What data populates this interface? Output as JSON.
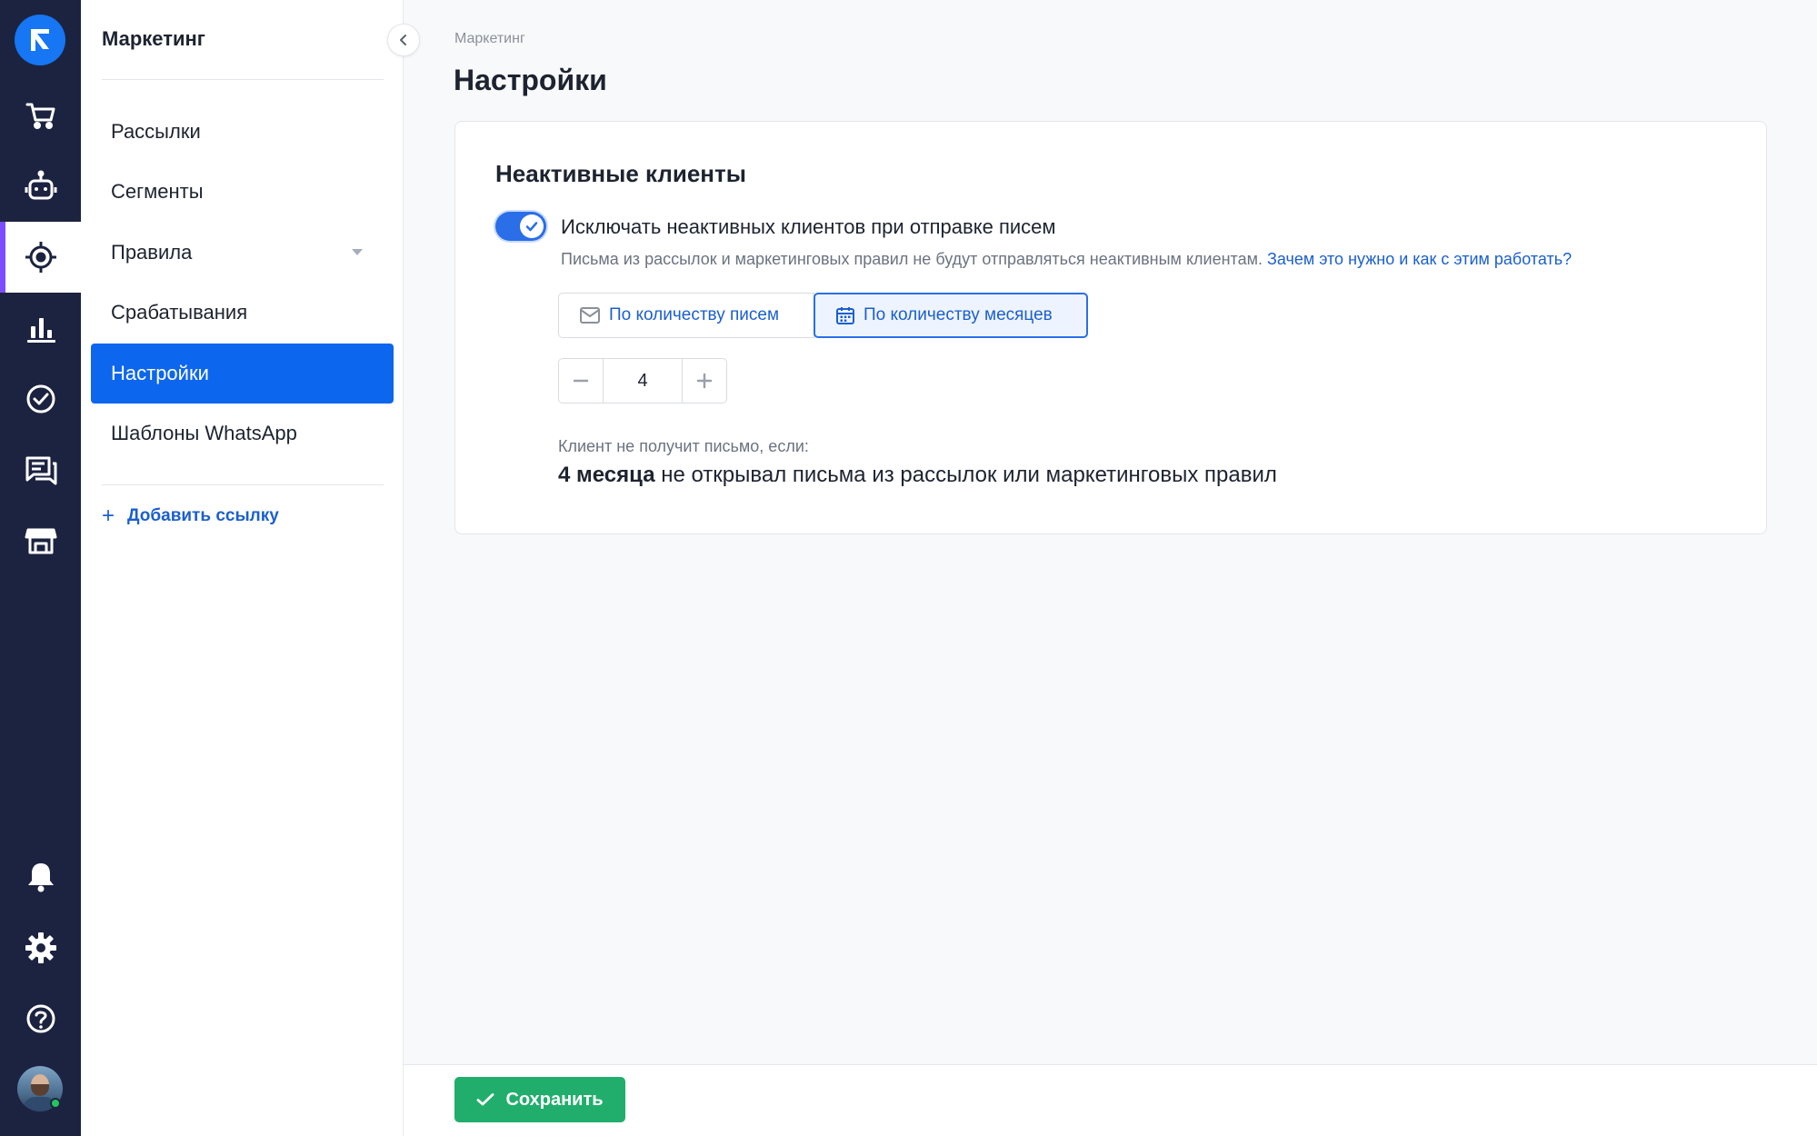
{
  "rail": {
    "items": [
      {
        "icon": "cart-icon"
      },
      {
        "icon": "robot-icon"
      },
      {
        "icon": "target-icon",
        "active": true
      },
      {
        "icon": "bar-chart-icon"
      },
      {
        "icon": "check-circle-icon"
      },
      {
        "icon": "chat-icon"
      },
      {
        "icon": "store-icon"
      }
    ],
    "bottom": [
      {
        "icon": "bell-icon"
      },
      {
        "icon": "gear-icon"
      },
      {
        "icon": "help-icon"
      }
    ],
    "colors": {
      "background": "#1c2340",
      "active_marker": "#7c4dff",
      "logo": "#1676f3"
    }
  },
  "sidebar": {
    "title": "Маркетинг",
    "items": [
      {
        "label": "Рассылки"
      },
      {
        "label": "Сегменты"
      },
      {
        "label": "Правила",
        "expandable": true
      },
      {
        "label": "Срабатывания"
      },
      {
        "label": "Настройки",
        "active": true
      },
      {
        "label": "Шаблоны WhatsApp"
      }
    ],
    "add_link": "Добавить ссылку",
    "active_color": "#0d66ee"
  },
  "breadcrumb": "Маркетинг",
  "page_title": "Настройки",
  "card": {
    "title": "Неактивные клиенты",
    "toggle": {
      "checked": true,
      "label": "Исключать неактивных клиентов при отправке писем"
    },
    "hint": {
      "text": "Письма из рассылок и маркетинговых правил не будут отправляться неактивным клиентам.",
      "link": "Зачем это нужно и как с этим работать?"
    },
    "segments": [
      {
        "label": "По количеству писем",
        "icon": "mail-icon",
        "selected": false
      },
      {
        "label": "По количеству месяцев",
        "icon": "calendar-icon",
        "selected": true
      }
    ],
    "stepper": {
      "value": "4"
    },
    "condition": {
      "label": "Клиент не получит письмо, если:",
      "bold": "4 месяца",
      "rest": "не открывал письма из рассылок или маркетинговых правил"
    }
  },
  "footer": {
    "save_label": "Сохранить",
    "save_color": "#21ae6c"
  }
}
